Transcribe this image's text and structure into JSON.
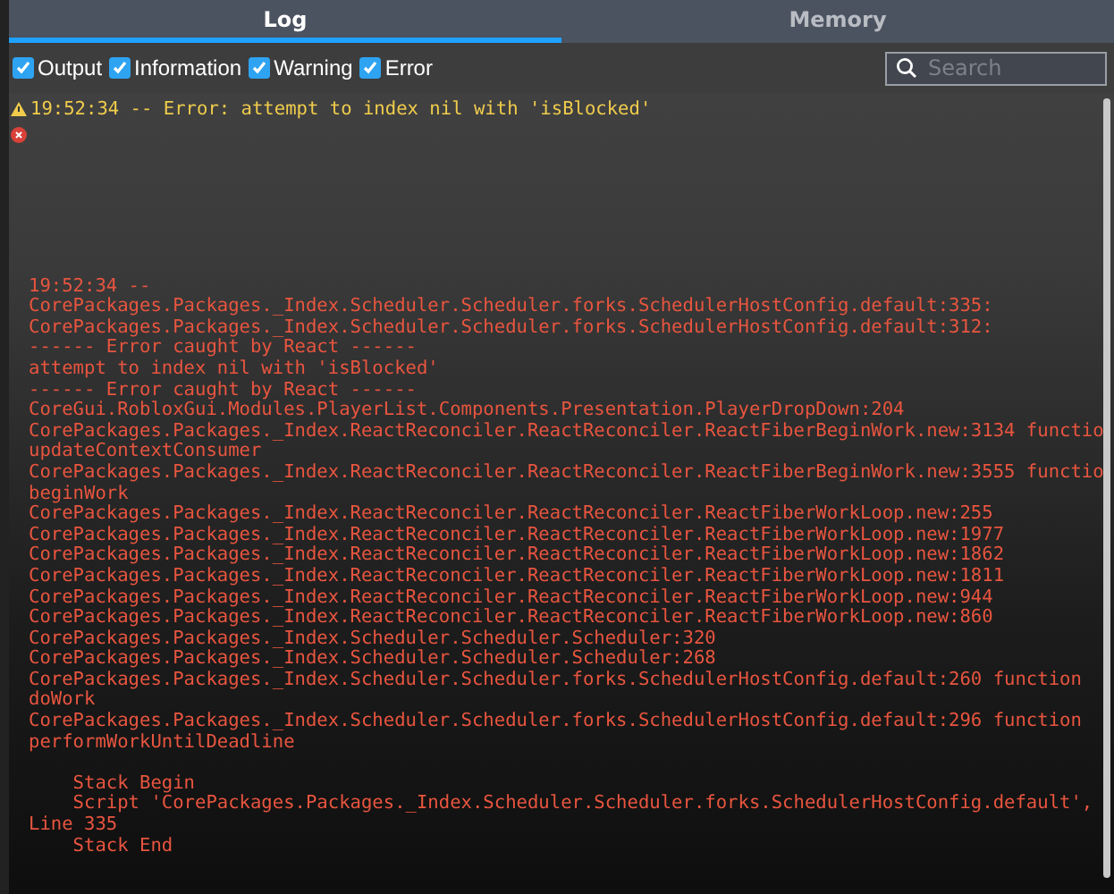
{
  "tabs": [
    {
      "label": "Log",
      "selected": true
    },
    {
      "label": "Memory",
      "selected": false
    }
  ],
  "filters": [
    {
      "label": "Output",
      "checked": true
    },
    {
      "label": "Information",
      "checked": true
    },
    {
      "label": "Warning",
      "checked": true
    },
    {
      "label": "Error",
      "checked": true
    }
  ],
  "search": {
    "placeholder": "Search"
  },
  "log": [
    {
      "kind": "warning",
      "lines": [
        "19:52:34 -- Error: attempt to index nil with 'isBlocked'"
      ]
    },
    {
      "kind": "error",
      "lines": [
        "19:52:34 --",
        "CorePackages.Packages._Index.Scheduler.Scheduler.forks.SchedulerHostConfig.default:335:",
        "CorePackages.Packages._Index.Scheduler.Scheduler.forks.SchedulerHostConfig.default:312:",
        "------ Error caught by React ------",
        "attempt to index nil with 'isBlocked'",
        "------ Error caught by React ------",
        "CoreGui.RobloxGui.Modules.PlayerList.Components.Presentation.PlayerDropDown:204",
        "CorePackages.Packages._Index.ReactReconciler.ReactReconciler.ReactFiberBeginWork.new:3134 functio",
        "updateContextConsumer",
        "CorePackages.Packages._Index.ReactReconciler.ReactReconciler.ReactFiberBeginWork.new:3555 functio",
        "beginWork",
        "CorePackages.Packages._Index.ReactReconciler.ReactReconciler.ReactFiberWorkLoop.new:255",
        "CorePackages.Packages._Index.ReactReconciler.ReactReconciler.ReactFiberWorkLoop.new:1977",
        "CorePackages.Packages._Index.ReactReconciler.ReactReconciler.ReactFiberWorkLoop.new:1862",
        "CorePackages.Packages._Index.ReactReconciler.ReactReconciler.ReactFiberWorkLoop.new:1811",
        "CorePackages.Packages._Index.ReactReconciler.ReactReconciler.ReactFiberWorkLoop.new:944",
        "CorePackages.Packages._Index.ReactReconciler.ReactReconciler.ReactFiberWorkLoop.new:860",
        "CorePackages.Packages._Index.Scheduler.Scheduler.Scheduler:320",
        "CorePackages.Packages._Index.Scheduler.Scheduler.Scheduler:268",
        "CorePackages.Packages._Index.Scheduler.Scheduler.forks.SchedulerHostConfig.default:260 function",
        "doWork",
        "CorePackages.Packages._Index.Scheduler.Scheduler.forks.SchedulerHostConfig.default:296 function",
        "performWorkUntilDeadline"
      ],
      "stack": [
        "Stack Begin",
        "Script 'CorePackages.Packages._Index.Scheduler.Scheduler.forks.SchedulerHostConfig.default', Line 335",
        "Stack End"
      ]
    }
  ]
}
